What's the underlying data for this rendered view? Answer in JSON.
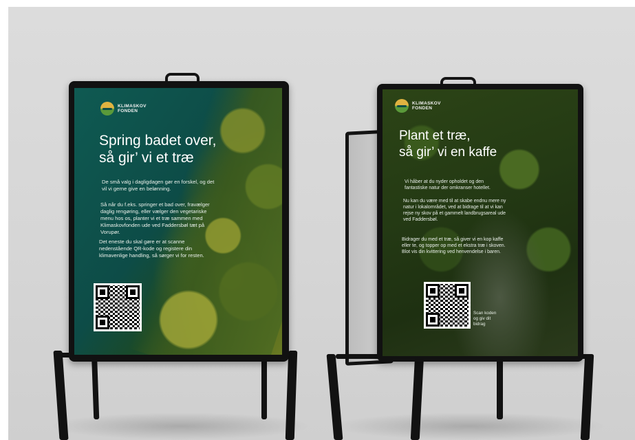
{
  "posters": [
    {
      "brand_line1": "KLIMASKOV",
      "brand_line2": "FONDEN",
      "headline": "Spring badet over,\nså gir’ vi et træ",
      "paragraphs": [
        "De små valg i dagligdagen gør en forskel, og det vil vi gerne give en belønning.",
        "Så når du f.eks. springer et bad over, fravælger daglig rengøring, eller vælger den vegetariske menu hos os, planter vi et træ sammen med Klimaskovfonden ude ved Faddersbøl tæt på Vorupør.",
        "Det eneste du skal gøre er at scanne nedenstående QR-kode og registere din klimavenlige handling, så sørger vi for resten."
      ]
    },
    {
      "brand_line1": "KLIMASKOV",
      "brand_line2": "FONDEN",
      "headline": "Plant et træ,\nså gir’ vi en kaffe",
      "paragraphs": [
        "Vi håber at du nyder opholdet og den fantastiske natur der omkranser hotellet.",
        "Nu kan du være med til at skabe endnu mere ny natur i lokalområdet, ved at bidrage til at vi kan rejse ny skov på et gammelt landbrugsareal ude ved Faddersbøl.",
        "Bidrager du med et træ, så giver vi en kop kaffe eller te, og topper op med et ekstra træ i skoven. Blot vis din kvittering ved henvendelse i baren."
      ],
      "scan_note": "Scan koden og giv dit bidrag"
    }
  ]
}
